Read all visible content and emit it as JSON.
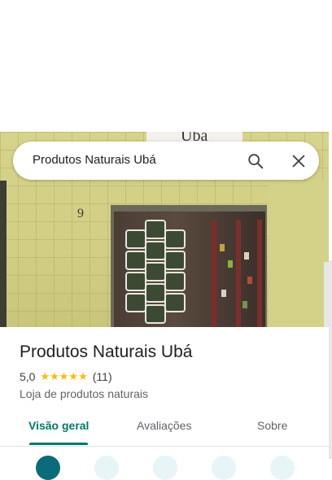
{
  "search": {
    "query": "Produtos Naturais Ubá"
  },
  "photo": {
    "sign_text": "Ubá",
    "house_number": "9"
  },
  "place": {
    "title": "Produtos Naturais Ubá",
    "rating": "5,0",
    "stars": "★★★★★",
    "review_count": "(11)",
    "category": "Loja de produtos naturais"
  },
  "tabs": [
    {
      "label": "Visão geral",
      "active": true
    },
    {
      "label": "Avaliações",
      "active": false
    },
    {
      "label": "Sobre",
      "active": false
    }
  ],
  "colors": {
    "accent": "#00796b",
    "star": "#fbbc04",
    "text": "#202124"
  }
}
